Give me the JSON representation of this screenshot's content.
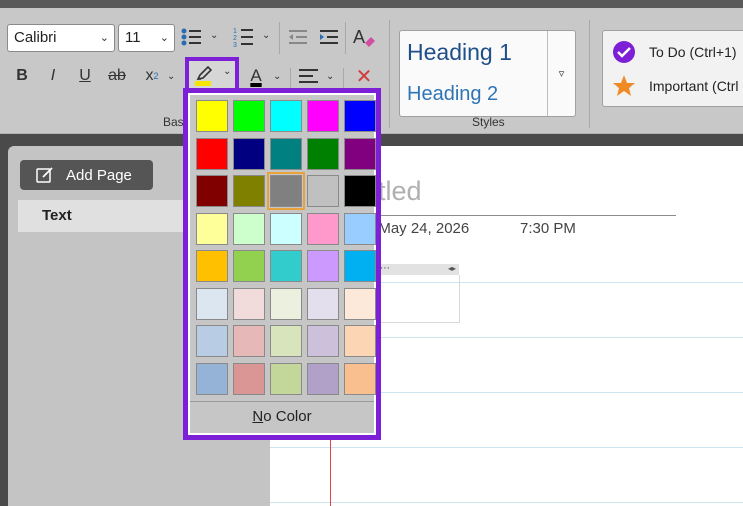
{
  "ribbon": {
    "font_name": "Calibri",
    "font_size": "11",
    "group_basic": "Bas",
    "group_styles": "Styles",
    "bold": "B",
    "italic": "I",
    "underline": "U",
    "strikethrough": "ab",
    "subscript": "x",
    "subscript_sub": "2",
    "font_color_letter": "A",
    "font_color_value": "#000000",
    "highlight_color_value": "#f5e600"
  },
  "styles": {
    "heading1": "Heading 1",
    "heading2": "Heading 2"
  },
  "tags": {
    "todo": "To Do (Ctrl+1)",
    "important": "Important (Ctrl"
  },
  "sidebar": {
    "add_page": "Add Page",
    "pages": [
      "Text"
    ]
  },
  "page": {
    "title_partial": "itled",
    "date": ", May 24, 2026",
    "time": "7:30 PM",
    "container_handle": "⋯"
  },
  "palette": {
    "colors": [
      [
        "#ffff00",
        "#00ff00",
        "#00ffff",
        "#ff00ff",
        "#0000ff"
      ],
      [
        "#ff0000",
        "#000080",
        "#008080",
        "#008000",
        "#800080"
      ],
      [
        "#800000",
        "#808000",
        "#808080",
        "#c0c0c0",
        "#000000"
      ],
      [
        "#ffff99",
        "#ccffcc",
        "#ccffff",
        "#ff99cc",
        "#99ccff"
      ],
      [
        "#ffc000",
        "#92d050",
        "#33cccc",
        "#cc99ff",
        "#00b0f0"
      ],
      [
        "#dce6f1",
        "#f2dcdb",
        "#ebf1de",
        "#e4dfec",
        "#fde9d9"
      ],
      [
        "#b8cce4",
        "#e6b8b7",
        "#d8e4bc",
        "#ccc0da",
        "#fcd5b4"
      ],
      [
        "#95b3d7",
        "#da9694",
        "#c4d79b",
        "#b1a0c7",
        "#fabf8f"
      ]
    ],
    "selected": "#808080",
    "no_color_first": "N",
    "no_color_rest": "o Color"
  },
  "icons": {
    "todo": "checkbox-check-icon",
    "important": "star-icon"
  }
}
